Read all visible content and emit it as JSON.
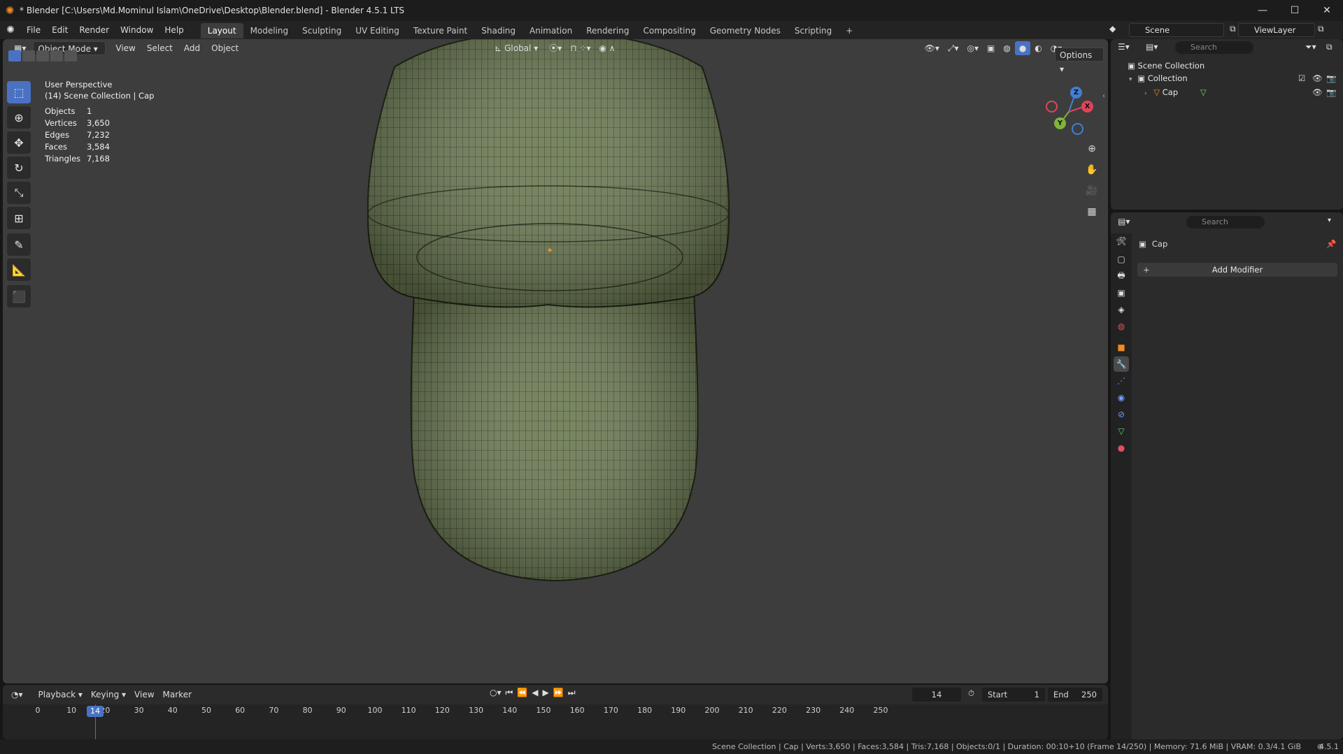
{
  "window": {
    "title": "* Blender [C:\\Users\\Md.Mominul Islam\\OneDrive\\Desktop\\Blender.blend] - Blender 4.5.1 LTS",
    "minimize": "—",
    "maximize": "☐",
    "close": "✕"
  },
  "menu": {
    "items": [
      "File",
      "Edit",
      "Render",
      "Window",
      "Help"
    ]
  },
  "workspaces": {
    "tabs": [
      "Layout",
      "Modeling",
      "Sculpting",
      "UV Editing",
      "Texture Paint",
      "Shading",
      "Animation",
      "Rendering",
      "Compositing",
      "Geometry Nodes",
      "Scripting"
    ],
    "active": "Layout",
    "add": "+"
  },
  "scene": {
    "name": "Scene",
    "view_layer": "ViewLayer"
  },
  "viewport": {
    "mode": "Object Mode",
    "menus": [
      "View",
      "Select",
      "Add",
      "Object"
    ],
    "orientation": "Global",
    "options": "Options",
    "perspective": "User Perspective",
    "context": "(14) Scene Collection | Cap",
    "stats": [
      {
        "label": "Objects",
        "value": "1"
      },
      {
        "label": "Vertices",
        "value": "3,650"
      },
      {
        "label": "Edges",
        "value": "7,232"
      },
      {
        "label": "Faces",
        "value": "3,584"
      },
      {
        "label": "Triangles",
        "value": "7,168"
      }
    ],
    "gizmo": {
      "x": "X",
      "y": "Y",
      "z": "Z"
    },
    "mesh_color": "#6b7a52",
    "wire_color": "#1e2414"
  },
  "outliner": {
    "search_placeholder": "Search",
    "root": "Scene Collection",
    "collection": "Collection",
    "object": "Cap"
  },
  "properties": {
    "search_placeholder": "Search",
    "object_name": "Cap",
    "add_modifier": "Add Modifier"
  },
  "timeline": {
    "menus": [
      "Playback",
      "Keying",
      "View",
      "Marker"
    ],
    "current_frame": "14",
    "start_label": "Start",
    "start": "1",
    "end_label": "End",
    "end": "250",
    "ticks": [
      "0",
      "10",
      "20",
      "30",
      "40",
      "50",
      "60",
      "70",
      "80",
      "90",
      "100",
      "110",
      "120",
      "130",
      "140",
      "150",
      "160",
      "170",
      "180",
      "190",
      "200",
      "210",
      "220",
      "230",
      "240",
      "250"
    ]
  },
  "status": {
    "text": "Scene Collection | Cap | Verts:3,650 | Faces:3,584 | Tris:7,168 | Objects:0/1 | Duration: 00:10+10 (Frame 14/250) | Memory: 71.6 MiB | VRAM: 0.3/4.1 GiB",
    "version": "4.5.1"
  },
  "colors": {
    "accent": "#4a72c4",
    "orange": "#f08a24"
  }
}
